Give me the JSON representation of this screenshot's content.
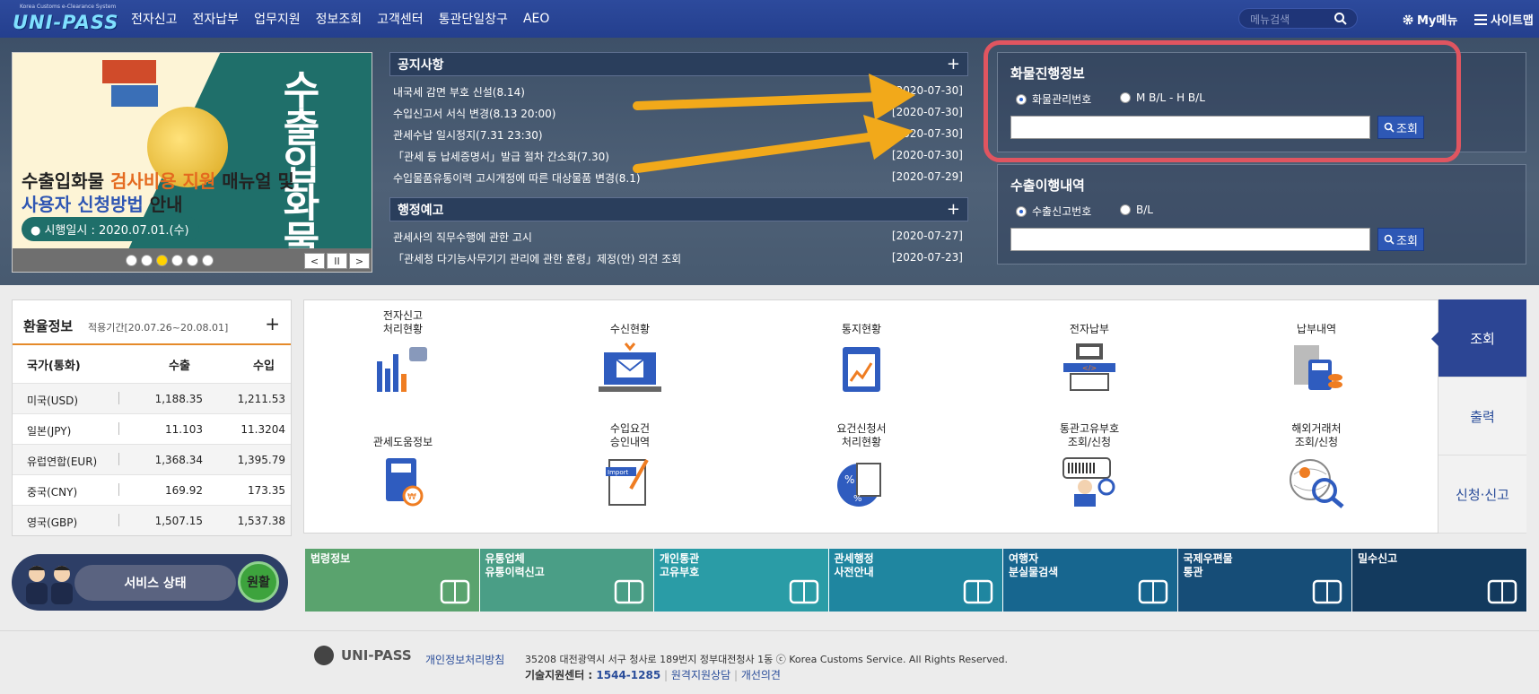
{
  "header": {
    "logo_small": "Korea Customs e-Clearance System",
    "logo": "UNI-PASS",
    "nav": [
      "전자신고",
      "전자납부",
      "업무지원",
      "정보조회",
      "고객센터",
      "통관단일창구",
      "AEO"
    ],
    "search_placeholder": "메뉴검색",
    "my_menu": "My메뉴",
    "sitemap": "사이트맵"
  },
  "banner": {
    "vertical_title": "수출입화물",
    "line1_pre": "수출입화물 ",
    "line1_accent": "검사비용 지원",
    "line1_post": " 매뉴얼 및",
    "line2_accent": "사용자 신청방법",
    "line2_post": " 안내",
    "date_pill": "● 시행일시 : 2020.07.01.(수)",
    "dots": 6,
    "active_dot": 2,
    "controls": [
      "<",
      "II",
      ">"
    ]
  },
  "notice": {
    "title": "공지사항",
    "plus": "+",
    "items": [
      {
        "title": "내국세 감면 부호 신설(8.14)",
        "date": "[2020-07-30]"
      },
      {
        "title": "수입신고서 서식 변경(8.13 20:00)",
        "date": "[2020-07-30]"
      },
      {
        "title": "관세수납 일시정지(7.31 23:30)",
        "date": "[2020-07-30]"
      },
      {
        "title": "「관세 등 납세증명서」발급 절차 간소화(7.30)",
        "date": "[2020-07-30]"
      },
      {
        "title": "수입물품유통이력 고시개정에 따른 대상물품 변경(8.1)",
        "date": "[2020-07-29]"
      }
    ]
  },
  "admin_notice": {
    "title": "행정예고",
    "plus": "+",
    "items": [
      {
        "title": "관세사의 직무수행에 관한 고시",
        "date": "[2020-07-27]"
      },
      {
        "title": "「관세청 다기능사무기기 관리에 관한 훈령」제정(안) 의견 조회",
        "date": "[2020-07-23]"
      }
    ]
  },
  "cargo": {
    "title": "화물진행정보",
    "radio1": "화물관리번호",
    "radio2": "M B/L - H B/L",
    "button": "조회"
  },
  "export": {
    "title": "수출이행내역",
    "radio1": "수출신고번호",
    "radio2": "B/L",
    "button": "조회"
  },
  "rates": {
    "title": "환율정보",
    "period": "적용기간[20.07.26~20.08.01]",
    "plus": "+",
    "columns": [
      "국가(통화)",
      "수출",
      "수입"
    ],
    "rows": [
      {
        "country": "미국(USD)",
        "export": "1,188.35",
        "import": "1,211.53"
      },
      {
        "country": "일본(JPY)",
        "export": "11.103",
        "import": "11.3204"
      },
      {
        "country": "유럽연합(EUR)",
        "export": "1,368.34",
        "import": "1,395.79"
      },
      {
        "country": "중국(CNY)",
        "export": "169.92",
        "import": "173.35"
      },
      {
        "country": "영국(GBP)",
        "export": "1,507.15",
        "import": "1,537.38"
      }
    ]
  },
  "quick": [
    {
      "label": "전자신고\n처리현황",
      "icon": "bar-chart-icon"
    },
    {
      "label": "수신현황",
      "icon": "monitor-mail-icon"
    },
    {
      "label": "통지현황",
      "icon": "clipboard-chart-icon"
    },
    {
      "label": "전자납부",
      "icon": "payment-terminal-icon"
    },
    {
      "label": "납부내역",
      "icon": "receipt-coins-icon"
    },
    {
      "label": "관세도움정보",
      "icon": "book-won-icon"
    },
    {
      "label": "수입요건\n승인내역",
      "icon": "import-document-icon"
    },
    {
      "label": "요건신청서\n처리현황",
      "icon": "percent-document-icon"
    },
    {
      "label": "통관고유부호\n조회/신청",
      "icon": "barcode-person-icon"
    },
    {
      "label": "해외거래처\n조회/신청",
      "icon": "globe-search-icon"
    }
  ],
  "side_tabs": [
    {
      "label": "조회",
      "active": true
    },
    {
      "label": "출력",
      "active": false
    },
    {
      "label": "신청·신고",
      "active": false
    }
  ],
  "service": {
    "label": "서비스 상태",
    "status": "원활"
  },
  "tiles": [
    {
      "label": "법령정보",
      "color": "#5aa36e",
      "icon": "book-icon"
    },
    {
      "label": "유통업체\n유통이력신고",
      "color": "#4a9e86",
      "icon": "stamp-icon"
    },
    {
      "label": "개인통관\n고유부호",
      "color": "#2a9ca6",
      "icon": "barcode-icon"
    },
    {
      "label": "관세행정\n사전안내",
      "color": "#1f86a0",
      "icon": "headset-icon"
    },
    {
      "label": "여행자\n분실물검색",
      "color": "#17668f",
      "icon": "box-question-icon"
    },
    {
      "label": "국제우편물\n통관",
      "color": "#164d77",
      "icon": "hand-truck-icon"
    },
    {
      "label": "밀수신고",
      "color": "#133a5e",
      "icon": "phone-24h-icon"
    }
  ],
  "footer": {
    "logo": "UNI-PASS",
    "privacy": "개인정보처리방침",
    "address": "35208 대전광역시 서구 청사로 189번지 정부대전청사 1동  ⓒ Korea Customs Service. All Rights Reserved.",
    "tech_label": "기술지원센터 : ",
    "tech_phone": "1544-1285",
    "remote": "원격지원상담",
    "improve": "개선의견"
  }
}
